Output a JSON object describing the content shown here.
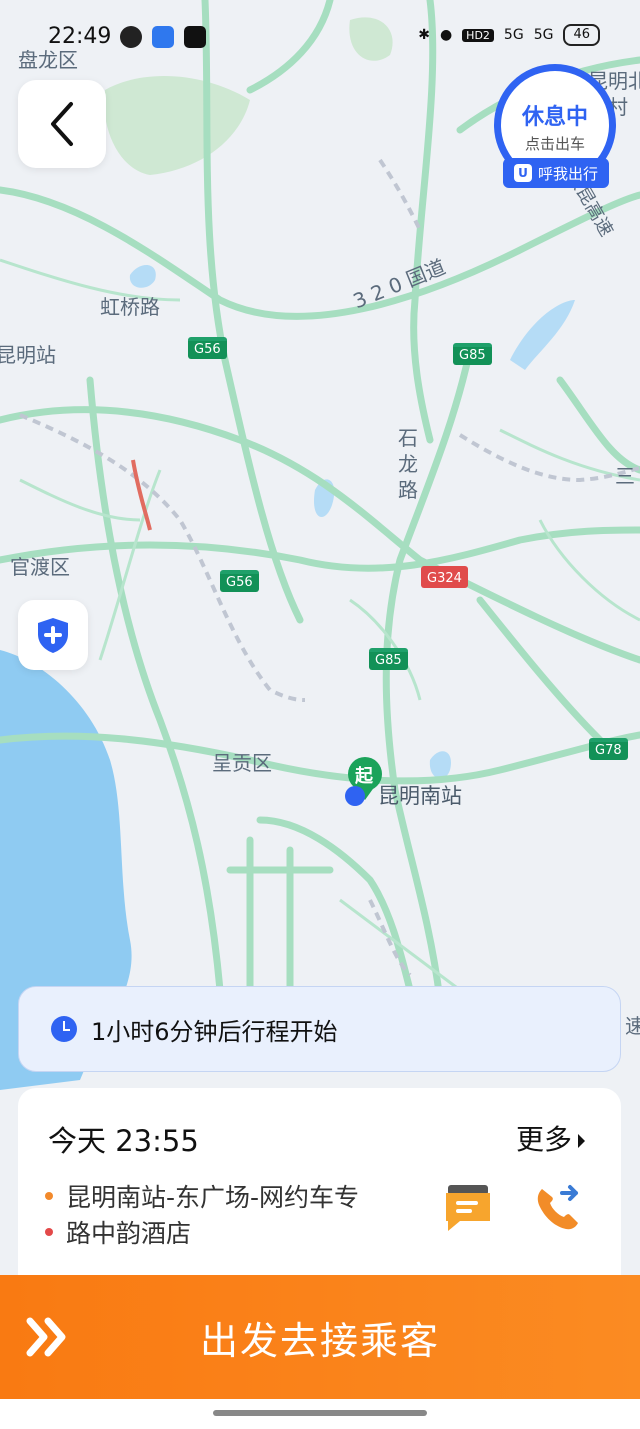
{
  "status_bar": {
    "time": "22:49",
    "hd_label": "HD2",
    "net1": "5G",
    "net2": "5G",
    "battery": "46"
  },
  "rest_status": {
    "title": "休息中",
    "subtitle": "点击出车",
    "call_tag": "呼我出行",
    "call_tag_icon": "U"
  },
  "map_labels": {
    "panlong": "盘龙区",
    "hongqiao": "虹桥路",
    "kunming_station": "昆明站",
    "national_320": "3 2 0 国道",
    "shilong": "石龙路",
    "guandu": "官渡区",
    "chenggong": "呈贡区",
    "kunming_south": "昆明南站",
    "start_marker": "起",
    "edge_top_right": "昆明北\n际村",
    "edge_yin": "银昆高速",
    "edge_san": "三",
    "edge_su": "速"
  },
  "road_shields": {
    "g56_a": "G56",
    "g56_b": "G56",
    "g85_a": "G85",
    "g85_b": "G85",
    "g324": "G324",
    "g78": "G78"
  },
  "trip_notice": {
    "text": "1小时6分钟后行程开始"
  },
  "order": {
    "time": "今天 23:55",
    "more": "更多",
    "pickup": "昆明南站-东广场-网约车专",
    "dropoff": "路中韵酒店",
    "pickup_color": "#f2892b",
    "dropoff_color": "#e34949"
  },
  "actions": {
    "depart": "出发去接乘客"
  },
  "colors": {
    "accent_blue": "#2f63f2",
    "accent_orange": "#f97a12",
    "road_green": "#9fdcb8",
    "water": "#8fcbf2"
  }
}
